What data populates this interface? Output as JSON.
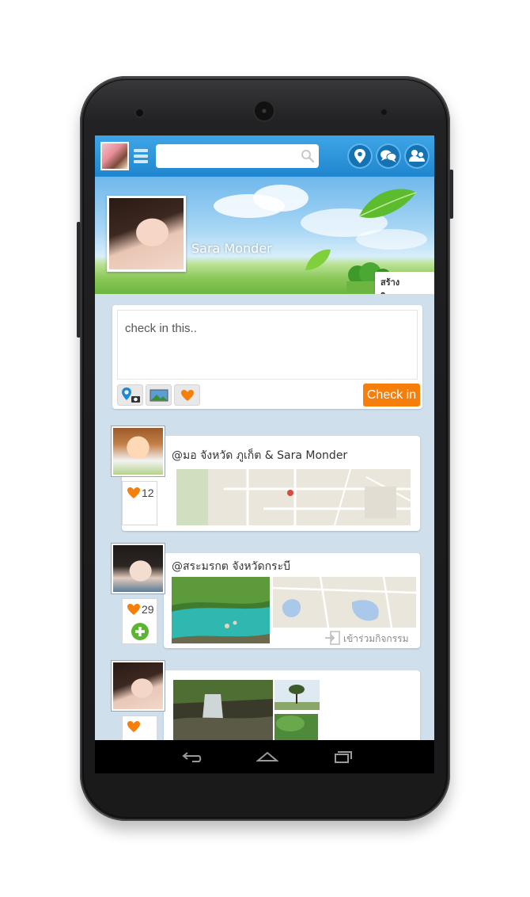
{
  "header": {
    "search_placeholder": "",
    "icons": [
      "avatar",
      "menu-icon",
      "search-icon",
      "location-pin-icon",
      "chat-icon",
      "friends-icon"
    ]
  },
  "profile": {
    "name": "Sara Monder",
    "create_activity_label": "สร้างกิจกรรม"
  },
  "composer": {
    "placeholder": "check in this..",
    "tools": [
      "location-camera-icon",
      "photo-icon",
      "heart-icon"
    ],
    "checkin_label": "Check in"
  },
  "feed": [
    {
      "title": "@มอ  จังหวัด ภูเก็ต & Sara Monder",
      "likes": "12",
      "media": "map"
    },
    {
      "title": "@สระมรกต จังหวัดกระบี",
      "likes": "29",
      "media": "photo-and-map",
      "join_label": "เข้าร่วมกิจกรรม"
    },
    {
      "title": "",
      "likes": "",
      "media": "photos"
    }
  ],
  "colors": {
    "topbar": "#1f86cf",
    "accent_orange": "#f57f0a",
    "background": "#cfe0ec",
    "join_green": "#5cb531"
  }
}
